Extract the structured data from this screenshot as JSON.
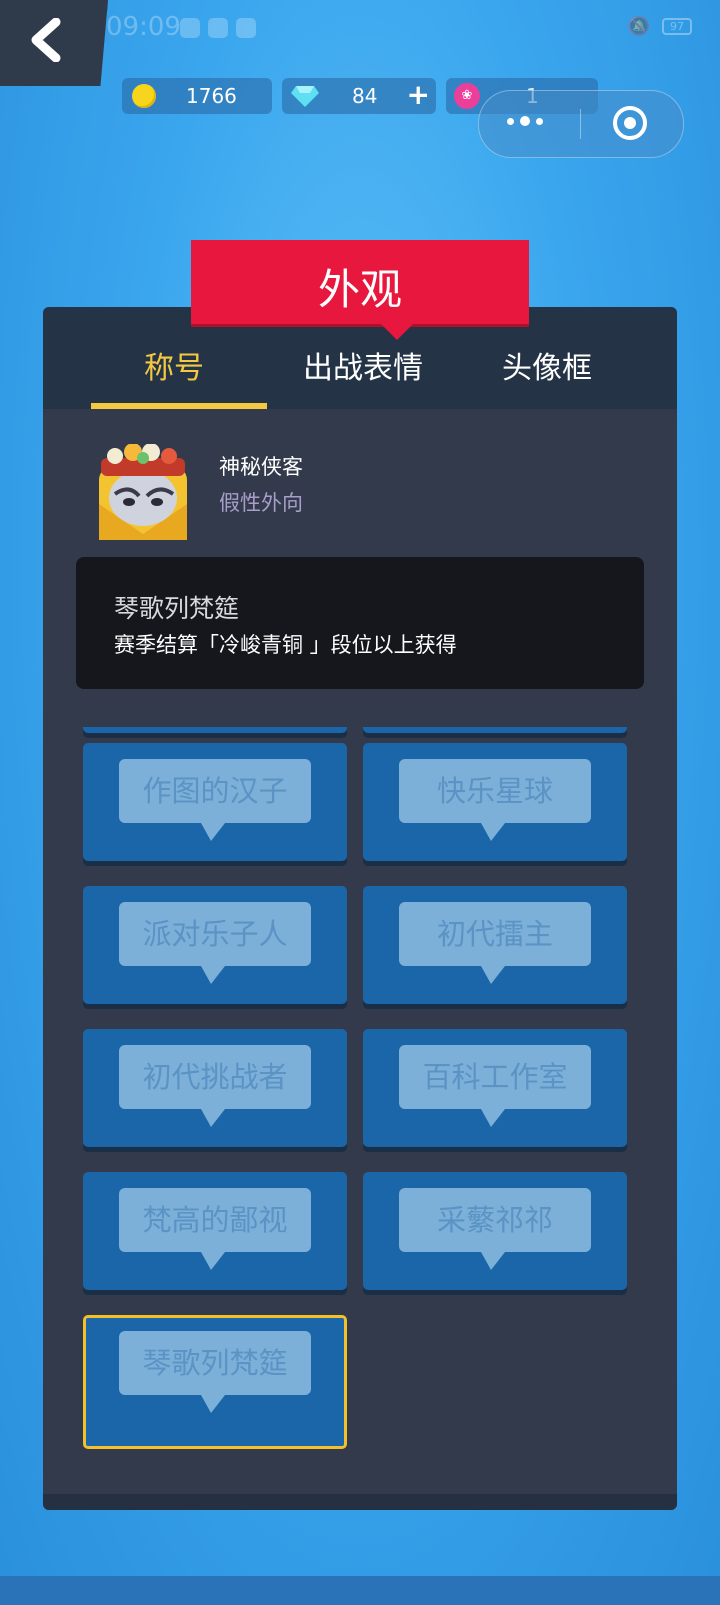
{
  "status_bar": {
    "signal": "ıl",
    "hd": "HD",
    "time": "09:09",
    "battery": "97"
  },
  "currencies": {
    "gold": "1766",
    "diamond": "84",
    "diamond_add": "+",
    "lotus": "1"
  },
  "header": {
    "title": "外观"
  },
  "tabs": [
    "称号",
    "出战表情",
    "头像框"
  ],
  "player": {
    "name": "神秘侠客",
    "tag": "假性外向"
  },
  "selected_title": {
    "name": "琴歌列梵筵",
    "requirement": "赛季结算「冷峻青铜 」段位以上获得"
  },
  "titles": [
    "作图的汉子",
    "快乐星球",
    "派对乐子人",
    "初代擂主",
    "初代挑战者",
    "百科工作室",
    "梵高的鄙视",
    "采蘩祁祁",
    "琴歌列梵筵"
  ],
  "colors": {
    "accent": "#f5c842",
    "ribbon": "#e8173d",
    "card": "#1b66a8",
    "panel": "#323a4c"
  }
}
